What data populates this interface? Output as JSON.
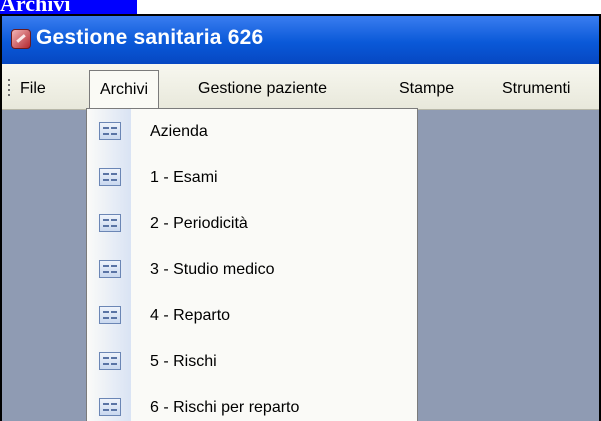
{
  "page_heading": "Archivi",
  "window": {
    "title": "Gestione sanitaria 626"
  },
  "menubar": {
    "items": [
      {
        "label": "File"
      },
      {
        "label": "Archivi"
      },
      {
        "label": "Gestione paziente"
      },
      {
        "label": "Stampe"
      },
      {
        "label": "Strumenti"
      }
    ]
  },
  "dropdown": {
    "items": [
      {
        "label": "Azienda",
        "icon": "form-icon"
      },
      {
        "label": "1 - Esami",
        "icon": "form-icon"
      },
      {
        "label": "2 - Periodicità",
        "icon": "form-icon"
      },
      {
        "label": "3 - Studio medico",
        "icon": "form-icon"
      },
      {
        "label": "4 - Reparto",
        "icon": "form-icon"
      },
      {
        "label": "5 - Rischi",
        "icon": "form-icon"
      },
      {
        "label": "6 - Rischi per reparto",
        "icon": "form-icon"
      }
    ]
  },
  "colors": {
    "titlebar": "#0a59d8",
    "heading_bg": "#0000ff",
    "workspace": "#8f9bb3"
  }
}
